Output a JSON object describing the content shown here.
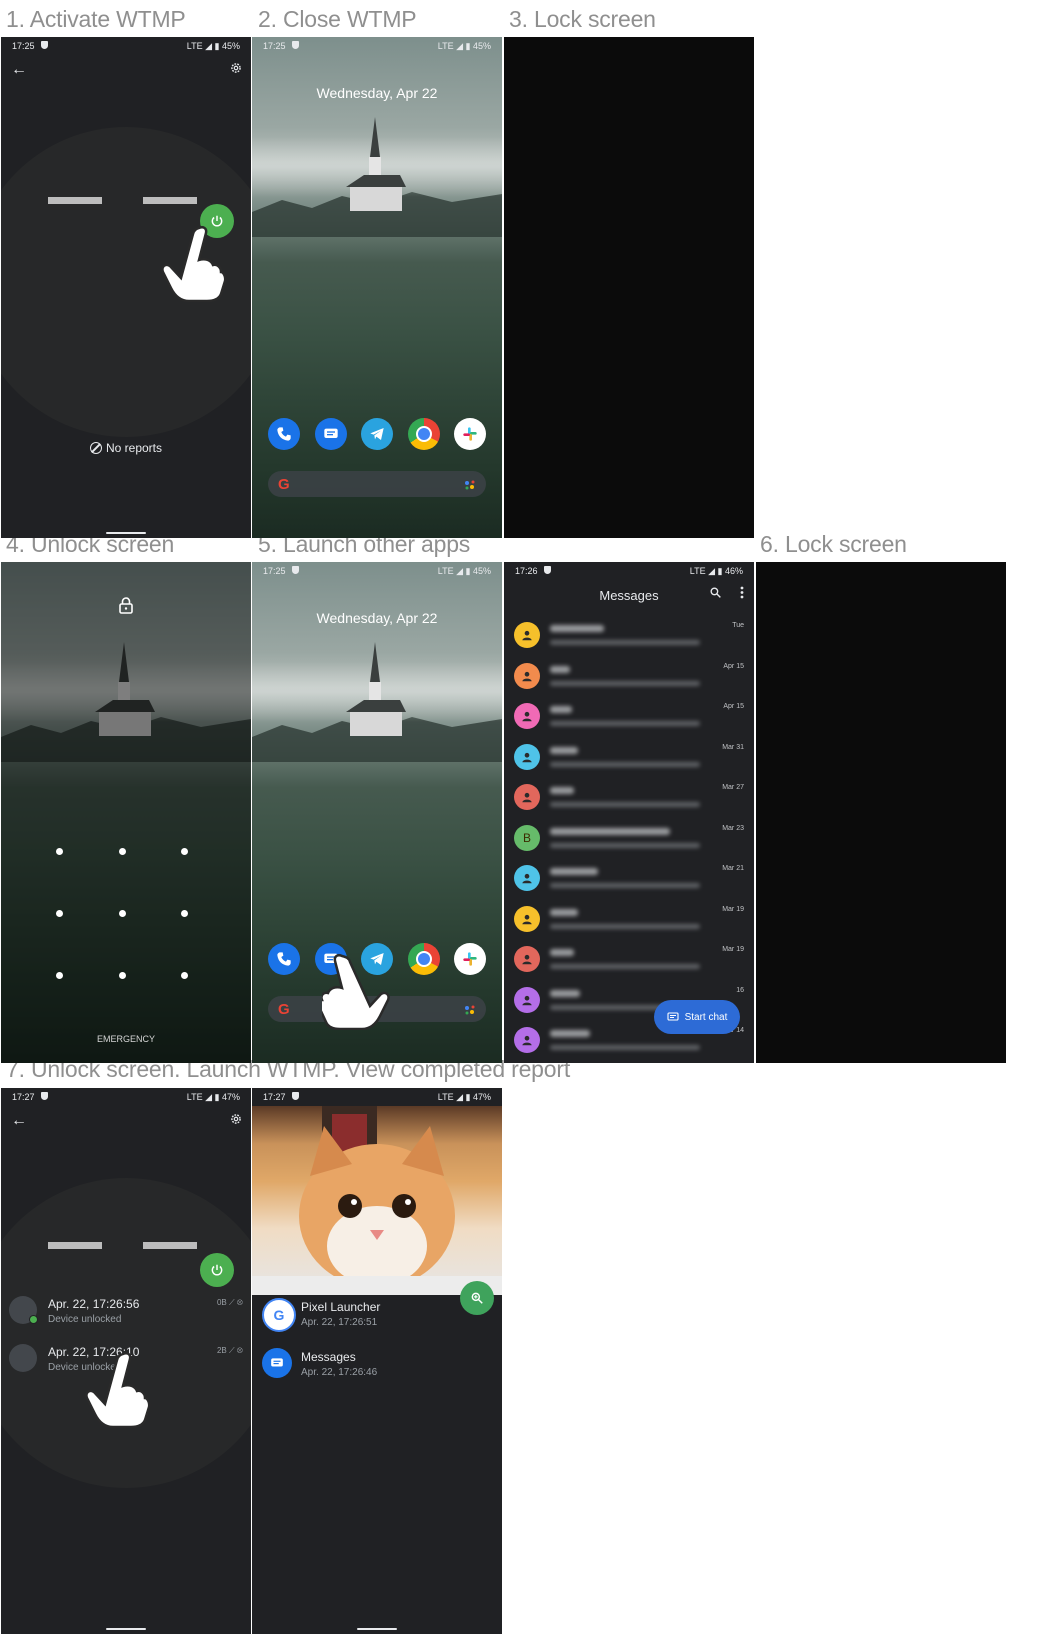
{
  "captions": {
    "c1": "1. Activate WTMP",
    "c2": "2. Close WTMP",
    "c3": "3. Lock screen",
    "c4": "4. Unlock screen",
    "c5": "5. Launch other apps",
    "c6": "6. Lock screen",
    "c7": "7. Unlock screen. Launch WTMP. View completed report"
  },
  "status": {
    "p1": {
      "time": "17:25",
      "right": "LTE ◢ ▮ 45%"
    },
    "p2": {
      "time": "17:25",
      "right": "LTE ◢ ▮ 45%"
    },
    "p5": {
      "time": "17:25",
      "right": "LTE ◢ ▮ 45%"
    },
    "p6": {
      "time": "17:26",
      "right": "LTE ◢ ▮ 46%"
    },
    "p7": {
      "time": "17:27",
      "right": "LTE ◢ ▮ 47%"
    },
    "p8": {
      "time": "17:27",
      "right": "LTE ◢ ▮ 47%"
    }
  },
  "wtmp_empty": {
    "no_reports": "No reports"
  },
  "home": {
    "date": "Wednesday, Apr 22",
    "search_logo": "G"
  },
  "lockscreen": {
    "emergency": "EMERGENCY"
  },
  "messages": {
    "title": "Messages",
    "fab_label": "Start chat",
    "rows": [
      {
        "date": "Tue",
        "avatar": "person",
        "color": "#f6c02b"
      },
      {
        "date": "Apr 15",
        "avatar": "person",
        "color": "#f28b4d"
      },
      {
        "date": "Apr 15",
        "avatar": "person",
        "color": "#f06ab5"
      },
      {
        "date": "Mar 31",
        "avatar": "person",
        "color": "#4fc3e8"
      },
      {
        "date": "Mar 27",
        "avatar": "person",
        "color": "#e2675c"
      },
      {
        "date": "Mar 23",
        "avatar": "B",
        "color": "#66bb6a"
      },
      {
        "date": "Mar 21",
        "avatar": "person",
        "color": "#4fc3e8"
      },
      {
        "date": "Mar 19",
        "avatar": "person",
        "color": "#f6c02b"
      },
      {
        "date": "Mar 19",
        "avatar": "person",
        "color": "#e2675c"
      },
      {
        "date": "16",
        "avatar": "person",
        "color": "#b46ee8"
      },
      {
        "date": "Mar 14",
        "avatar": "person",
        "color": "#b46ee8"
      }
    ]
  },
  "reports": [
    {
      "title": "Apr. 22, 17:26:56",
      "subtitle": "Device unlocked",
      "stats": "0B ⟋ ⊗"
    },
    {
      "title": "Apr. 22, 17:26:10",
      "subtitle": "Device unlocked",
      "stats": "2B ⟋ ⊗"
    }
  ],
  "report_detail": {
    "apps": [
      {
        "name": "Pixel Launcher",
        "time": "Apr. 22, 17:26:51",
        "icon": "google-g-icon"
      },
      {
        "name": "Messages",
        "time": "Apr. 22, 17:26:46",
        "icon": "messages-icon"
      }
    ]
  },
  "colors": {
    "wtmp_green": "#4caf50",
    "messages_blue": "#2d6bd6",
    "dark_bg": "#202124"
  }
}
